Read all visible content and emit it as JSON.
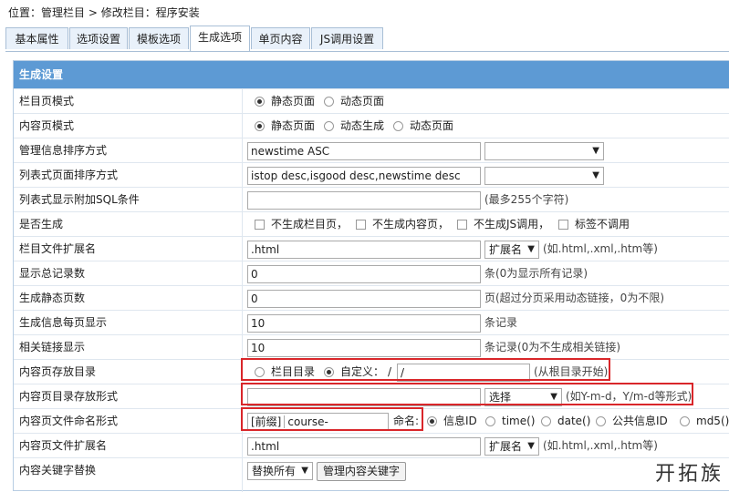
{
  "breadcrumb": {
    "prefix": "位置：",
    "item1": "管理栏目",
    "sep": " > ",
    "item2": "修改栏目：程序安装"
  },
  "tabs": [
    {
      "label": "基本属性"
    },
    {
      "label": "选项设置"
    },
    {
      "label": "模板选项"
    },
    {
      "label": "生成选项"
    },
    {
      "label": "单页内容"
    },
    {
      "label": "JS调用设置"
    }
  ],
  "active_tab": "生成选项",
  "panel": {
    "title": "生成设置"
  },
  "rows": {
    "list_mode": {
      "label": "栏目页模式",
      "opt1": "静态页面",
      "opt2": "动态页面"
    },
    "content_mode": {
      "label": "内容页模式",
      "opt1": "静态页面",
      "opt2": "动态生成",
      "opt3": "动态页面"
    },
    "info_sort": {
      "label": "管理信息排序方式",
      "value": "newstime ASC"
    },
    "list_sort": {
      "label": "列表式页面排序方式",
      "value": "istop desc,isgood desc,newstime desc"
    },
    "sql": {
      "label": "列表式显示附加SQL条件",
      "value": "",
      "note": "(最多255个字符)"
    },
    "generate": {
      "label": "是否生成",
      "opt1": "不生成栏目页，",
      "opt2": "不生成内容页，",
      "opt3": "不生成JS调用，",
      "opt4": "标签不调用"
    },
    "list_ext": {
      "label": "栏目文件扩展名",
      "value": ".html",
      "select": "扩展名",
      "note": "(如.html,.xml,.htm等)"
    },
    "total": {
      "label": "显示总记录数",
      "value": "0",
      "note": "条(0为显示所有记录)"
    },
    "static_pages": {
      "label": "生成静态页数",
      "value": "0",
      "note": "页(超过分页采用动态链接，0为不限)"
    },
    "per_page": {
      "label": "生成信息每页显示",
      "value": "10",
      "note": "条记录"
    },
    "related": {
      "label": "相关链接显示",
      "value": "10",
      "note": "条记录(0为不生成相关链接)"
    },
    "content_dir": {
      "label": "内容页存放目录",
      "opt1": "栏目目录",
      "opt2": "自定义：",
      "slash": "/",
      "value": "/",
      "note": "(从根目录开始)"
    },
    "dir_form": {
      "label": "内容页目录存放形式",
      "value": "",
      "select": "选择",
      "note": "(如Y-m-d，Y/m-d等形式)"
    },
    "naming": {
      "label": "内容页文件命名形式",
      "prefix_label": "[前缀]",
      "prefix_value": "course-",
      "name_label": "命名:",
      "opt1": "信息ID",
      "opt2": "time()",
      "opt3": "date()",
      "opt4": "公共信息ID",
      "opt5": "md5()"
    },
    "content_ext": {
      "label": "内容页文件扩展名",
      "value": ".html",
      "select": "扩展名",
      "note": "(如.html,.xml,.htm等)"
    },
    "keyword": {
      "label": "内容关键字替换",
      "select": "替换所有",
      "button": "管理内容关键字"
    }
  },
  "watermark": "开拓族"
}
